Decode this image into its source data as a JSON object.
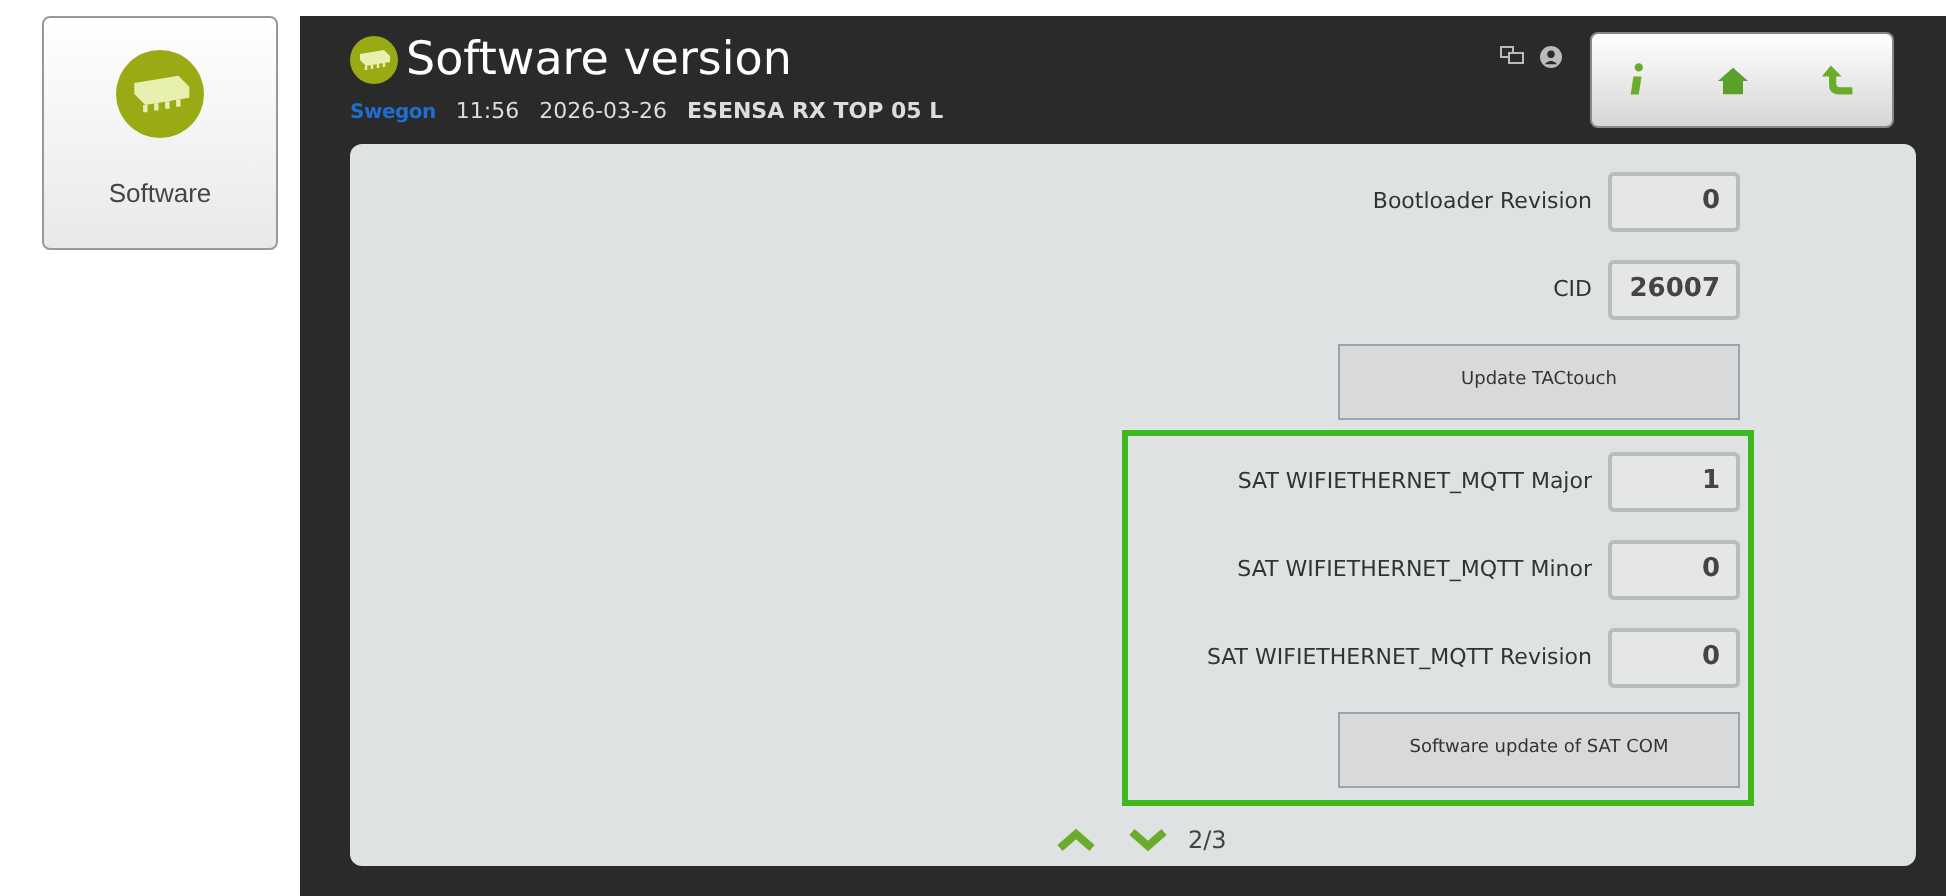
{
  "tile": {
    "label": "Software"
  },
  "header": {
    "title": "Software version",
    "logo": "Swegon",
    "time": "11:56",
    "date": "2026-03-26",
    "unit": "ESENSA RX TOP 05 L"
  },
  "sections": [
    {
      "highlighted": false,
      "items": [
        {
          "kind": "field",
          "label": "Bootloader Revision",
          "value": "0"
        },
        {
          "kind": "field",
          "label": "CID",
          "value": "26007"
        },
        {
          "kind": "button",
          "label": "Update TACtouch"
        }
      ]
    },
    {
      "highlighted": true,
      "items": [
        {
          "kind": "field",
          "label": "SAT WIFIETHERNET_MQTT Major",
          "value": "1"
        },
        {
          "kind": "field",
          "label": "SAT WIFIETHERNET_MQTT Minor",
          "value": "0"
        },
        {
          "kind": "field",
          "label": "SAT WIFIETHERNET_MQTT Revision",
          "value": "0"
        },
        {
          "kind": "button",
          "label": "Software update of SAT COM"
        }
      ]
    }
  ],
  "pager": {
    "page": "2/3"
  }
}
